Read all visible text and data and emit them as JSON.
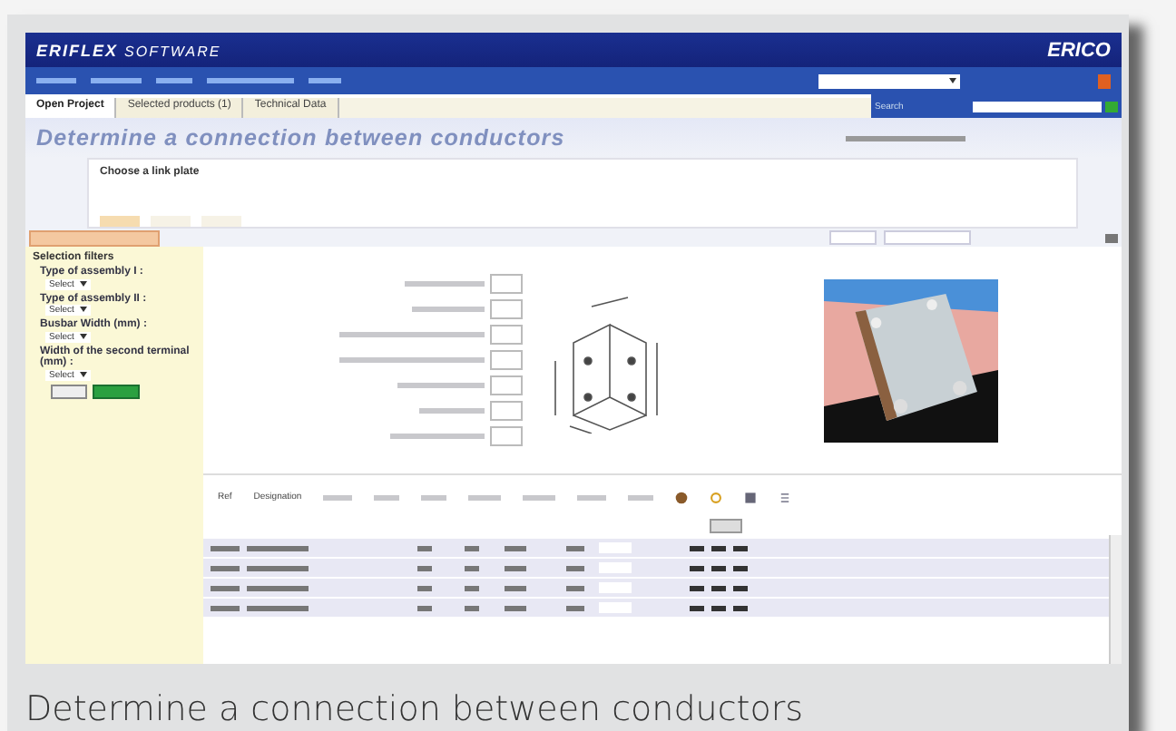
{
  "app": {
    "logo": "ERIFLEX",
    "logo_suffix": "SOFTWARE",
    "brand": "ERICO"
  },
  "tabs": [
    {
      "label": "Open Project",
      "selected": true
    },
    {
      "label": "Selected products (1)",
      "selected": false
    },
    {
      "label": "Technical Data",
      "selected": false
    }
  ],
  "search": {
    "scope": "Search"
  },
  "page_title": "Determine a connection between conductors",
  "step_box": {
    "heading": "Choose a link plate",
    "steps": [
      {
        "selected": true
      },
      {
        "selected": false
      },
      {
        "selected": false
      }
    ]
  },
  "filters": {
    "title": "Selection filters",
    "groups": [
      {
        "label": "Type of assembly I :",
        "value": "Select"
      },
      {
        "label": "Type of assembly II :",
        "value": "Select"
      },
      {
        "label": "Busbar Width (mm) :",
        "value": "Select"
      },
      {
        "label": "Width of the second terminal (mm) :",
        "value": "Select"
      }
    ]
  },
  "table": {
    "columns": [
      "Ref",
      "Designation"
    ]
  },
  "caption": "Determine a connection between conductors"
}
